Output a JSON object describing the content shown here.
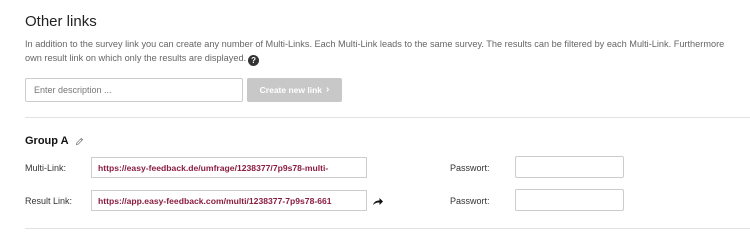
{
  "section": {
    "title": "Other links",
    "description_line1": "In addition to the survey link you can create any number of Multi-Links. Each Multi-Link leads to the same survey. The results can be filtered by each Multi-Link. Furthermore",
    "description_line2": "own result link on which only the results are displayed.",
    "help_icon_glyph": "?"
  },
  "create": {
    "description_placeholder": "Enter description ...",
    "description_value": "",
    "button_label": "Create new link",
    "button_chevron": "›"
  },
  "group": {
    "title": "Group A",
    "multi_link_label": "Multi-Link:",
    "multi_link_value": "https://easy-feedback.de/umfrage/1238377/7p9s78-multi-",
    "result_link_label": "Result Link:",
    "result_link_value": "https://app.easy-feedback.com/multi/1238377-7p9s78-661",
    "password_label": "Passwort:",
    "multi_password_value": "",
    "result_password_value": ""
  },
  "icons": {
    "help": "help-icon",
    "edit": "pencil-icon",
    "open": "arrow-right-icon",
    "chevron": "chevron-right-icon"
  },
  "colors": {
    "link_text": "#8b1d3f",
    "button_disabled": "#c8c8c8",
    "help_icon_bg": "#333333"
  }
}
